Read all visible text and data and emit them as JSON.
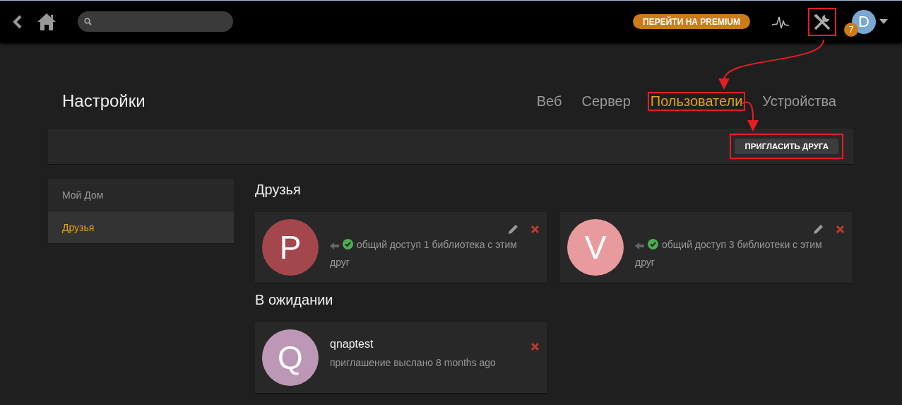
{
  "topbar": {
    "premium_button": "ПЕРЕЙТИ НА PREMIUM",
    "settings_highlighted": true,
    "notification_count": "7",
    "avatar_letter": "D"
  },
  "page_title": "Настройки",
  "tabs": [
    {
      "label": "Веб",
      "selected": false,
      "highlighted": false
    },
    {
      "label": "Сервер",
      "selected": false,
      "highlighted": false
    },
    {
      "label": "Пользователи",
      "selected": true,
      "highlighted": true
    },
    {
      "label": "Устройства",
      "selected": false,
      "highlighted": false
    }
  ],
  "invite_button": {
    "label": "ПРИГЛАСИТЬ ДРУГА",
    "highlighted": true
  },
  "sidebar": {
    "items": [
      {
        "label": "Мой Дом",
        "selected": false
      },
      {
        "label": "Друзья",
        "selected": true
      }
    ]
  },
  "sections": [
    {
      "title": "Друзья",
      "cards": [
        {
          "kind": "friend",
          "letter": "P",
          "color": "#a3474d",
          "status": "общий доступ 1 библиотека с этим друг"
        },
        {
          "kind": "friend",
          "letter": "V",
          "color": "#e89b9e",
          "status": "общий доступ 3 библиотеки с этим друг"
        }
      ]
    },
    {
      "title": "В ожидании",
      "cards": [
        {
          "kind": "pending",
          "letter": "Q",
          "color": "#bc98b6",
          "name": "qnaptest",
          "status": "приглашение выслано 8 months ago"
        }
      ]
    }
  ]
}
